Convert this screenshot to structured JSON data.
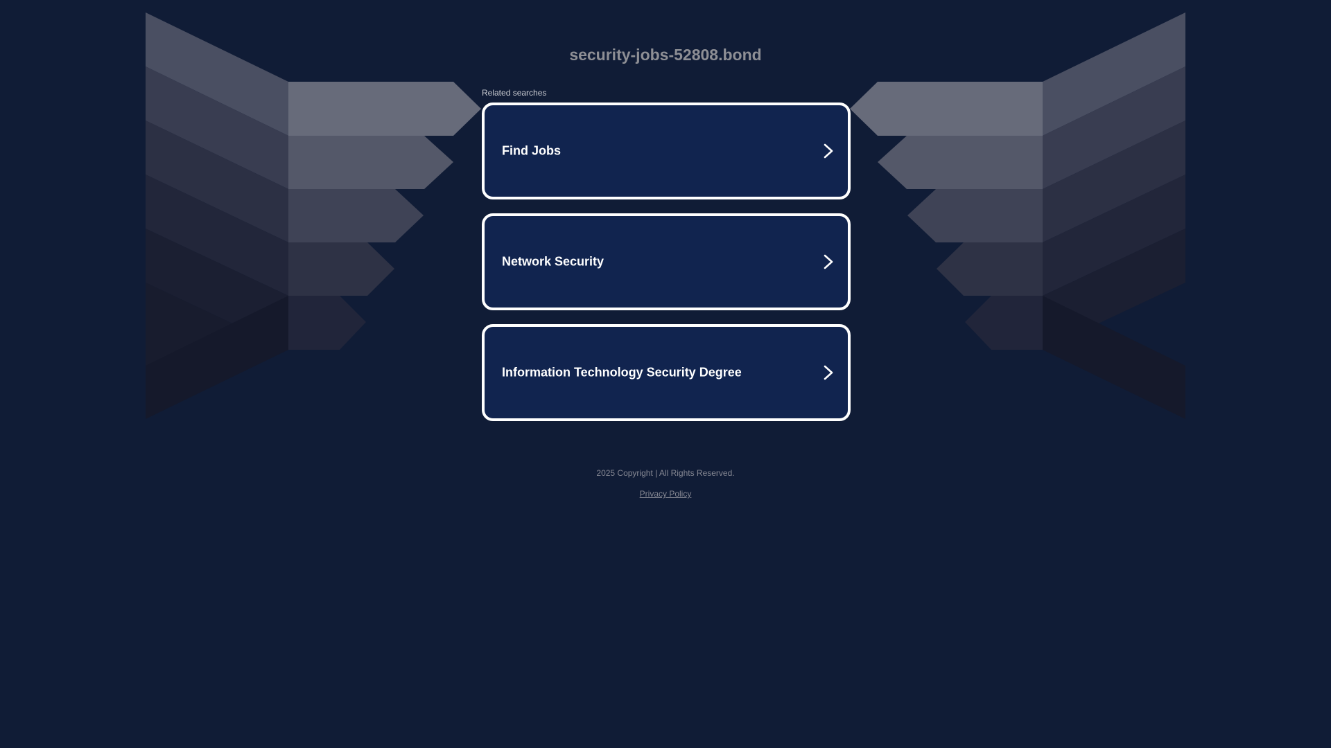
{
  "page": {
    "domain": "security-jobs-52808.bond",
    "related_label": "Related searches",
    "links": [
      {
        "label": "Find Jobs",
        "icon": "chevron-right-icon"
      },
      {
        "label": "Network Security",
        "icon": "chevron-right-icon"
      },
      {
        "label": "Information Technology Security Degree",
        "icon": "chevron-right-icon"
      }
    ],
    "copyright": "2025 Copyright | All Rights Reserved.",
    "privacy_link": "Privacy Policy"
  },
  "colors": {
    "background": "#101c36",
    "card_fill": "#11244f",
    "card_border": "#ffffff",
    "title_text": "#8e8f95",
    "footer_text": "#868893"
  }
}
